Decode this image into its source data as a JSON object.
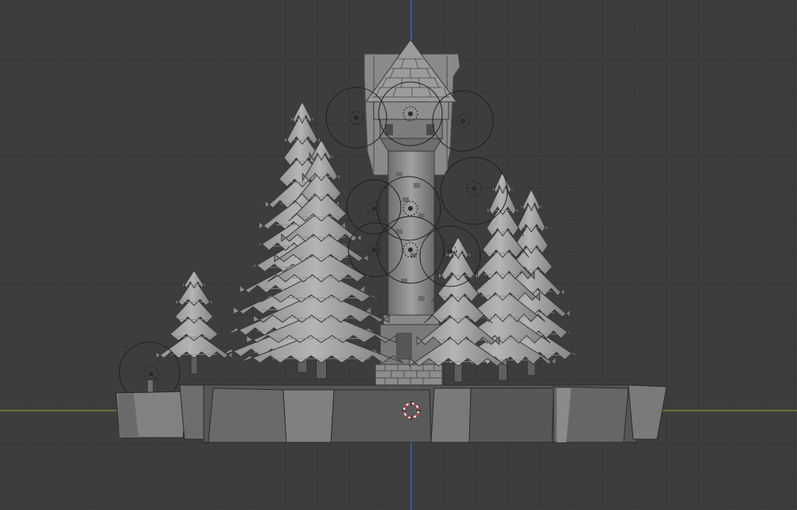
{
  "viewport": {
    "view": "front-orthographic",
    "grid_visible": true,
    "colors": {
      "background": "#3d3d3d",
      "grid_line": "#333333",
      "x_axis": "#6a8a2e",
      "z_axis": "#3f67b0",
      "model_light": "#a3a3a3",
      "model_mid": "#7e7e7e",
      "model_dark": "#5c5c5c",
      "outline": "#2b2b2b",
      "cursor_red": "#d23a3a"
    }
  },
  "scene": {
    "objects": [
      "base-platform",
      "wizard-tower",
      "pine-tree",
      "light-gizmo",
      "3d-cursor"
    ]
  }
}
